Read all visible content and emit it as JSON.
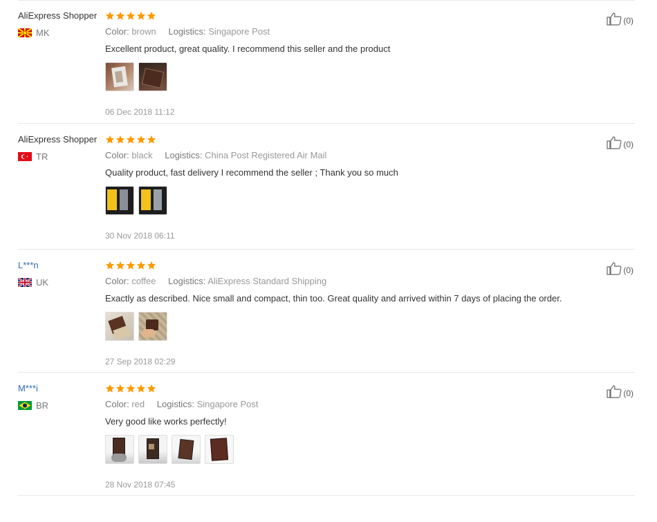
{
  "reviews": [
    {
      "user": "AliExpress Shopper",
      "country": "MK",
      "color_label": "Color:",
      "color": "brown",
      "logistics_label": "Logistics:",
      "logistics": "Singapore Post",
      "text": "Excellent product, great quality. I recommend this seller and the product",
      "date": "06 Dec 2018 11:12",
      "likes": "(0)",
      "stars": 5
    },
    {
      "user": "AliExpress Shopper",
      "country": "TR",
      "color_label": "Color:",
      "color": "black",
      "logistics_label": "Logistics:",
      "logistics": "China Post Registered Air Mail",
      "text": "Quality product, fast delivery I recommend the seller ; Thank you so much",
      "date": "30 Nov 2018 06:11",
      "likes": "(0)",
      "stars": 5
    },
    {
      "user": "L***n",
      "country": "UK",
      "color_label": "Color:",
      "color": "coffee",
      "logistics_label": "Logistics:",
      "logistics": "AliExpress Standard Shipping",
      "text": "Exactly as described. Nice small and compact, thin too. Great quality and arrived within 7 days of placing the order.",
      "date": "27 Sep 2018 02:29",
      "likes": "(0)",
      "stars": 5
    },
    {
      "user": "M***i",
      "country": "BR",
      "color_label": "Color:",
      "color": "red",
      "logistics_label": "Logistics:",
      "logistics": "Singapore Post",
      "text": "Very good like works perfectly!",
      "date": "28 Nov 2018 07:45",
      "likes": "(0)",
      "stars": 5
    }
  ],
  "colors": {
    "star": "#ff9a00",
    "username_link": "#2e6ab1",
    "muted": "#999999"
  }
}
